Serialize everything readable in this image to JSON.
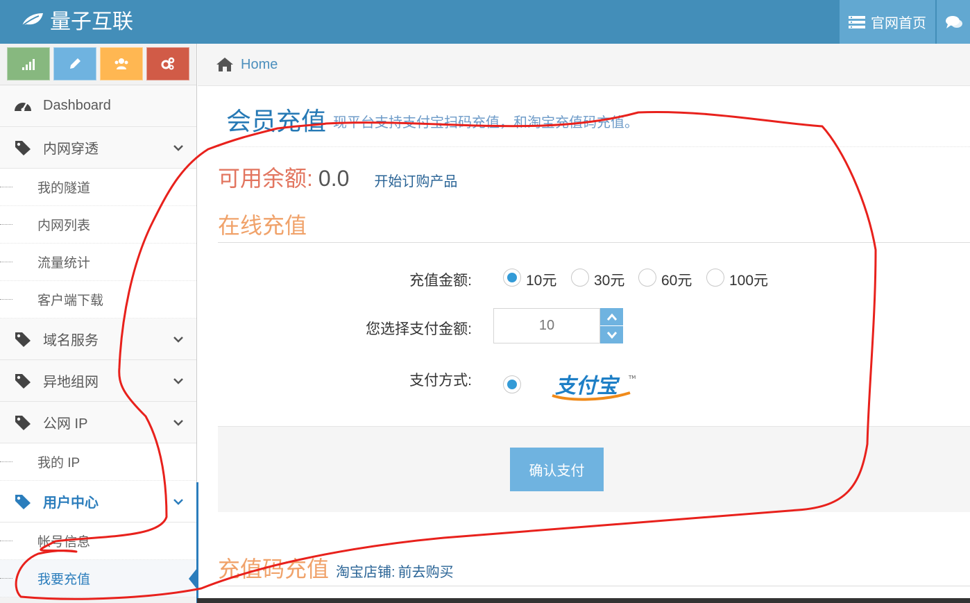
{
  "navbar": {
    "brand": "量子互联",
    "brand_icon": "leaf-icon",
    "home_link": "官网首页",
    "home_icon": "list-icon",
    "messages_icon": "comments-icon",
    "colors": {
      "bar": "#438eb9",
      "button": "#62a8d1"
    }
  },
  "shortcuts": [
    {
      "icon": "signal-icon",
      "color": "#87b87f"
    },
    {
      "icon": "pencil-icon",
      "color": "#6fb3e0"
    },
    {
      "icon": "users-icon",
      "color": "#ffb752"
    },
    {
      "icon": "cogs-icon",
      "color": "#d15b47"
    }
  ],
  "sidebar": {
    "dashboard": "Dashboard",
    "intranet": {
      "label": "内网穿透",
      "items": [
        "我的隧道",
        "内网列表",
        "流量统计",
        "客户端下载"
      ]
    },
    "domain": {
      "label": "域名服务"
    },
    "remote_network": {
      "label": "异地组网"
    },
    "public_ip": {
      "label": "公网 IP",
      "items": [
        "我的 IP"
      ]
    },
    "user_center": {
      "label": "用户中心",
      "items": [
        "帐号信息",
        "我要充值"
      ],
      "active_item": "我要充值"
    }
  },
  "breadcrumb": {
    "home": "Home"
  },
  "page": {
    "title": "会员充值",
    "subtitle": "现平台支持支付宝扫码充值，和淘宝充值码充值。"
  },
  "balance": {
    "label": "可用余额:",
    "value": "0.0",
    "order_link": "开始订购产品"
  },
  "online_recharge": {
    "title": "在线充值",
    "amount_label": "充值金额:",
    "options": [
      "10元",
      "30元",
      "60元",
      "100元"
    ],
    "selected": "10元",
    "pay_amount_label": "您选择支付金额:",
    "pay_amount_value": "10",
    "method_label": "支付方式:",
    "method_logo": "支付宝",
    "confirm": "确认支付"
  },
  "code_recharge": {
    "title": "充值码充值",
    "shop_label": "淘宝店铺:",
    "shop_link": "前去购买"
  },
  "annotation_color": "#e8211c"
}
